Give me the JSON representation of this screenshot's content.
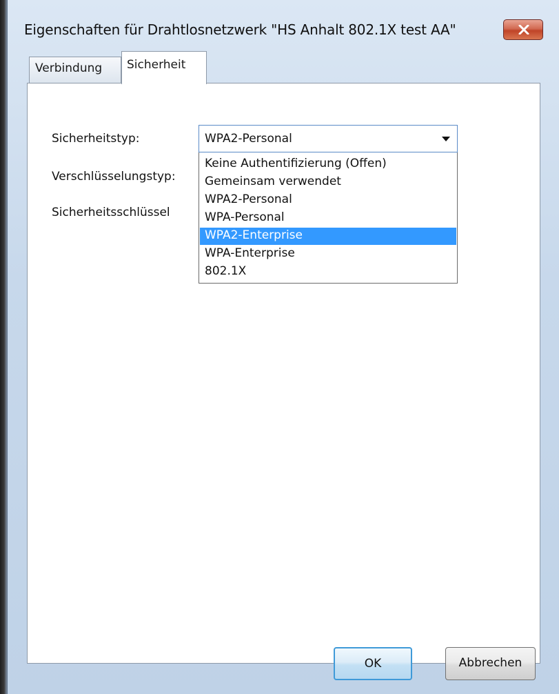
{
  "window": {
    "title": "Eigenschaften für Drahtlosnetzwerk \"HS Anhalt 802.1X test AA\"",
    "close_icon": "close-x-icon"
  },
  "tabs": [
    {
      "label": "Verbindung",
      "active": false
    },
    {
      "label": "Sicherheit",
      "active": true
    }
  ],
  "form": {
    "security_type_label": "Sicherheitstyp:",
    "encryption_type_label": "Verschlüsselungstyp:",
    "security_key_label": "Sicherheitsschlüssel",
    "security_type_value": "WPA2-Personal"
  },
  "dropdown": {
    "options": [
      "Keine Authentifizierung (Offen)",
      "Gemeinsam verwendet",
      "WPA2-Personal",
      "WPA-Personal",
      "WPA2-Enterprise",
      "WPA-Enterprise",
      "802.1X"
    ],
    "highlighted": "WPA2-Enterprise"
  },
  "buttons": {
    "ok": "OK",
    "cancel": "Abbrechen"
  },
  "colors": {
    "highlight": "#3399ff",
    "close_button": "#c84a2e",
    "focus_border": "#3f9ad8"
  }
}
